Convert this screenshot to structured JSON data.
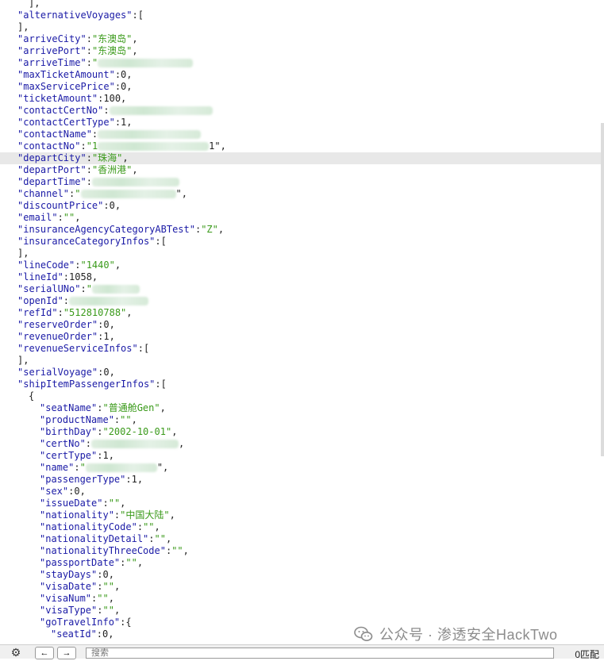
{
  "editor": {
    "lines": [
      {
        "i": 2,
        "t": "],"
      },
      {
        "i": 1,
        "k": "\"alternativeVoyages\"",
        "v": ":["
      },
      {
        "i": 1,
        "t": "],"
      },
      {
        "i": 1,
        "k": "\"arriveCity\"",
        "v": ":",
        "s": "\"东澳岛\"",
        "e": ","
      },
      {
        "i": 1,
        "k": "\"arrivePort\"",
        "v": ":",
        "s": "\"东澳岛\"",
        "e": ","
      },
      {
        "i": 1,
        "k": "\"arriveTime\"",
        "v": ":",
        "s": "\"",
        "e": "",
        "blur": true
      },
      {
        "i": 1,
        "k": "\"maxTicketAmount\"",
        "v": ":0,"
      },
      {
        "i": 1,
        "k": "\"maxServicePrice\"",
        "v": ":0,"
      },
      {
        "i": 1,
        "k": "\"ticketAmount\"",
        "v": ":100,"
      },
      {
        "i": 1,
        "k": "\"contactCertNo\"",
        "v": ":",
        "blur": true
      },
      {
        "i": 1,
        "k": "\"contactCertType\"",
        "v": ":1,"
      },
      {
        "i": 1,
        "k": "\"contactName\"",
        "v": ":",
        "blur": true
      },
      {
        "i": 1,
        "k": "\"contactNo\"",
        "v": ":",
        "s": "\"1",
        "e": "1\",",
        "blur": true
      },
      {
        "i": 1,
        "k": "\"departCity\"",
        "v": ":",
        "s": "\"珠海\"",
        "e": ",",
        "hl": true
      },
      {
        "i": 1,
        "k": "\"departPort\"",
        "v": ":",
        "s": "\"香洲港\"",
        "e": ","
      },
      {
        "i": 1,
        "k": "\"departTime\"",
        "v": ":",
        "blur": true
      },
      {
        "i": 1,
        "k": "\"channel\"",
        "v": ":",
        "s": "\"",
        "e": "\",",
        "blur": true
      },
      {
        "i": 1,
        "k": "\"discountPrice\"",
        "v": ":0,"
      },
      {
        "i": 1,
        "k": "\"email\"",
        "v": ":",
        "s": "\"\"",
        "e": ","
      },
      {
        "i": 1,
        "k": "\"insuranceAgencyCategoryABTest\"",
        "v": ":",
        "s": "\"Z\"",
        "e": ","
      },
      {
        "i": 1,
        "k": "\"insuranceCategoryInfos\"",
        "v": ":["
      },
      {
        "i": 1,
        "t": "],"
      },
      {
        "i": 1,
        "k": "\"lineCode\"",
        "v": ":",
        "s": "\"1440\"",
        "e": ","
      },
      {
        "i": 1,
        "k": "\"lineId\"",
        "v": ":1058,"
      },
      {
        "i": 1,
        "k": "\"serialUNo\"",
        "v": ":",
        "s": "\"",
        "blur": true
      },
      {
        "i": 1,
        "k": "\"openId\"",
        "v": ":",
        "blur": true
      },
      {
        "i": 1,
        "k": "\"refId\"",
        "v": ":",
        "s": "\"512810788\"",
        "e": ","
      },
      {
        "i": 1,
        "k": "\"reserveOrder\"",
        "v": ":0,"
      },
      {
        "i": 1,
        "k": "\"revenueOrder\"",
        "v": ":1,"
      },
      {
        "i": 1,
        "k": "\"revenueServiceInfos\"",
        "v": ":["
      },
      {
        "i": 1,
        "t": "],"
      },
      {
        "i": 1,
        "k": "\"serialVoyage\"",
        "v": ":0,"
      },
      {
        "i": 1,
        "k": "\"shipItemPassengerInfos\"",
        "v": ":["
      },
      {
        "i": 2,
        "t": "{"
      },
      {
        "i": 3,
        "k": "\"seatName\"",
        "v": ":",
        "s": "\"普通舱Gen\"",
        "e": ","
      },
      {
        "i": 3,
        "k": "\"productName\"",
        "v": ":",
        "s": "\"\"",
        "e": ","
      },
      {
        "i": 3,
        "k": "\"birthDay\"",
        "v": ":",
        "s": "\"2002-10-01\"",
        "e": ","
      },
      {
        "i": 3,
        "k": "\"certNo\"",
        "v": ":",
        "e": ",",
        "blur": true
      },
      {
        "i": 3,
        "k": "\"certType\"",
        "v": ":1,"
      },
      {
        "i": 3,
        "k": "\"name\"",
        "v": ":",
        "s": "\"",
        "e": "\",",
        "blur": true
      },
      {
        "i": 3,
        "k": "\"passengerType\"",
        "v": ":1,"
      },
      {
        "i": 3,
        "k": "\"sex\"",
        "v": ":0,"
      },
      {
        "i": 3,
        "k": "\"issueDate\"",
        "v": ":",
        "s": "\"\"",
        "e": ","
      },
      {
        "i": 3,
        "k": "\"nationality\"",
        "v": ":",
        "s": "\"中国大陆\"",
        "e": ","
      },
      {
        "i": 3,
        "k": "\"nationalityCode\"",
        "v": ":",
        "s": "\"\"",
        "e": ","
      },
      {
        "i": 3,
        "k": "\"nationalityDetail\"",
        "v": ":",
        "s": "\"\"",
        "e": ","
      },
      {
        "i": 3,
        "k": "\"nationalityThreeCode\"",
        "v": ":",
        "s": "\"\"",
        "e": ","
      },
      {
        "i": 3,
        "k": "\"passportDate\"",
        "v": ":",
        "s": "\"\"",
        "e": ","
      },
      {
        "i": 3,
        "k": "\"stayDays\"",
        "v": ":0,"
      },
      {
        "i": 3,
        "k": "\"visaDate\"",
        "v": ":",
        "s": "\"\"",
        "e": ","
      },
      {
        "i": 3,
        "k": "\"visaNum\"",
        "v": ":",
        "s": "\"\"",
        "e": ","
      },
      {
        "i": 3,
        "k": "\"visaType\"",
        "v": ":",
        "s": "\"\"",
        "e": ","
      },
      {
        "i": 3,
        "k": "\"goTravelInfo\"",
        "v": ":{"
      },
      {
        "i": 4,
        "k": "\"seatId\"",
        "v": ":0,"
      }
    ]
  },
  "watermark": {
    "text": "公众号 · 渗透安全HackTwo"
  },
  "findbar": {
    "gear_icon": "⚙",
    "prev_icon": "←",
    "next_icon": "→",
    "search_placeholder": "搜索",
    "matches": "0匹配"
  },
  "colors": {
    "key": "#1a1aa6",
    "string": "#3a9a1a",
    "highlight": "#e8e8e8"
  }
}
